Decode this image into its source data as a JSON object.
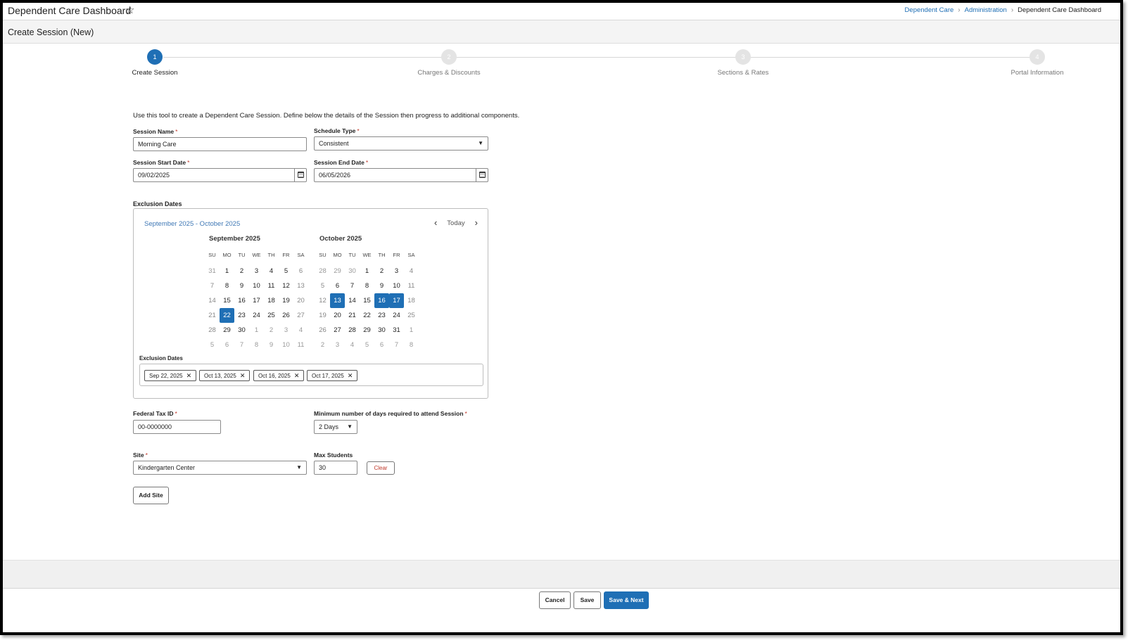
{
  "header": {
    "app_title": "Dependent Care Dashboard",
    "breadcrumb": [
      "Dependent Care",
      "Administration",
      "Dependent Care Dashboard"
    ]
  },
  "page": {
    "title": "Create Session (New)"
  },
  "stepper": {
    "steps": [
      {
        "number": "1",
        "label": "Create Session",
        "active": true
      },
      {
        "number": "2",
        "label": "Charges & Discounts",
        "active": false
      },
      {
        "number": "3",
        "label": "Sections & Rates",
        "active": false
      },
      {
        "number": "4",
        "label": "Portal Information",
        "active": false
      }
    ]
  },
  "form": {
    "intro": "Use this tool to create a Dependent Care Session. Define below the details of the Session then progress to additional components.",
    "session_name": {
      "label": "Session Name",
      "value": "Morning Care"
    },
    "schedule_type": {
      "label": "Schedule Type",
      "value": "Consistent"
    },
    "start_date": {
      "label": "Session Start Date",
      "value": "09/02/2025"
    },
    "end_date": {
      "label": "Session End Date",
      "value": "06/05/2026"
    },
    "exclusion": {
      "title": "Exclusion Dates",
      "range_label": "September 2025 - October 2025",
      "today_label": "Today",
      "dow": [
        "SU",
        "MO",
        "TU",
        "WE",
        "TH",
        "FR",
        "SA"
      ],
      "months": [
        {
          "title": "September 2025",
          "weeks": [
            [
              "31",
              "1",
              "2",
              "3",
              "4",
              "5",
              "6"
            ],
            [
              "7",
              "8",
              "9",
              "10",
              "11",
              "12",
              "13"
            ],
            [
              "14",
              "15",
              "16",
              "17",
              "18",
              "19",
              "20"
            ],
            [
              "21",
              "22",
              "23",
              "24",
              "25",
              "26",
              "27"
            ],
            [
              "28",
              "29",
              "30",
              "1",
              "2",
              "3",
              "4"
            ],
            [
              "5",
              "6",
              "7",
              "8",
              "9",
              "10",
              "11"
            ]
          ],
          "selected": [
            "22"
          ]
        },
        {
          "title": "October 2025",
          "weeks": [
            [
              "28",
              "29",
              "30",
              "1",
              "2",
              "3",
              "4"
            ],
            [
              "5",
              "6",
              "7",
              "8",
              "9",
              "10",
              "11"
            ],
            [
              "12",
              "13",
              "14",
              "15",
              "16",
              "17",
              "18"
            ],
            [
              "19",
              "20",
              "21",
              "22",
              "23",
              "24",
              "25"
            ],
            [
              "26",
              "27",
              "28",
              "29",
              "30",
              "31",
              "1"
            ],
            [
              "2",
              "3",
              "4",
              "5",
              "6",
              "7",
              "8"
            ]
          ],
          "selected": [
            "13",
            "16",
            "17"
          ]
        }
      ],
      "chips_label": "Exclusion Dates",
      "chips": [
        "Sep 22, 2025",
        "Oct 13, 2025",
        "Oct 16, 2025",
        "Oct 17, 2025"
      ]
    },
    "federal_tax_id": {
      "label": "Federal Tax ID",
      "value": "00-0000000"
    },
    "min_days": {
      "label": "Minimum number of days required to attend Session",
      "value": "2 Days"
    },
    "site": {
      "label": "Site",
      "value": "Kindergarten Center"
    },
    "max_students": {
      "label": "Max Students",
      "value": "30"
    },
    "clear_label": "Clear",
    "add_site_label": "Add Site"
  },
  "footer": {
    "cancel_label": "Cancel",
    "save_label": "Save",
    "save_next_label": "Save & Next"
  },
  "colors": {
    "accent": "#1f6fb5",
    "required": "#c0392b"
  }
}
